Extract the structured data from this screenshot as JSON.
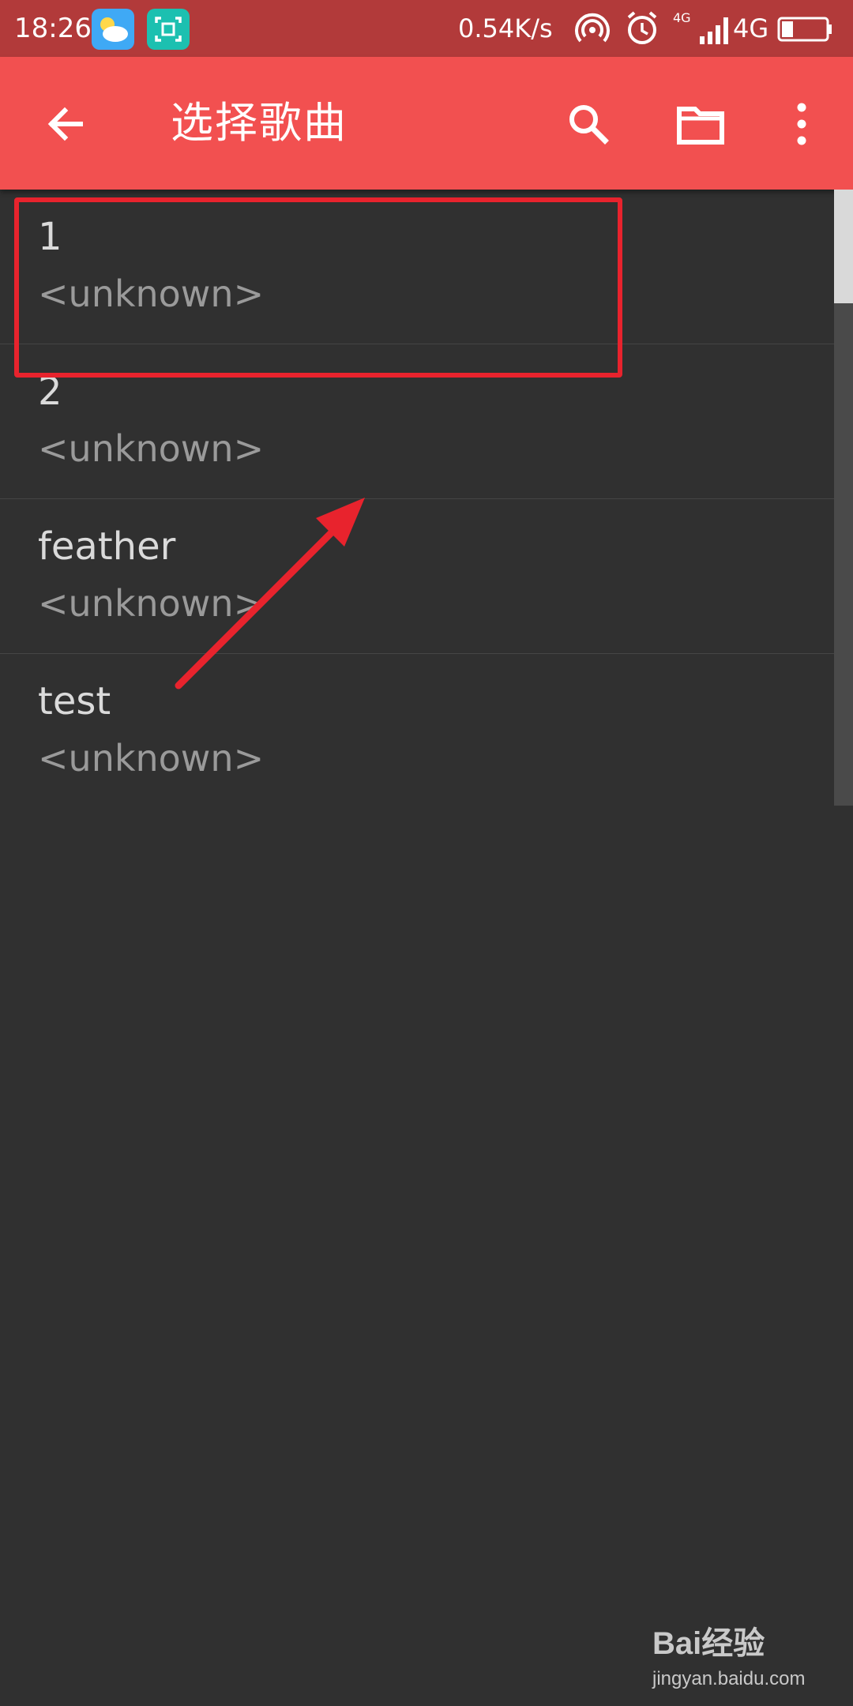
{
  "status_bar": {
    "time": "18:26",
    "network_speed": "0.54K/s",
    "network_type": "4G",
    "small_network_label": "4G",
    "icons": [
      "weather-app-icon",
      "scanner-app-icon",
      "hotspot-icon",
      "alarm-icon",
      "signal-icon",
      "battery-icon"
    ]
  },
  "app_bar": {
    "title": "选择歌曲",
    "background": "#f25050",
    "icons": [
      "back-arrow-icon",
      "search-icon",
      "folder-icon",
      "more-vert-icon"
    ]
  },
  "songs": [
    {
      "title": "1",
      "artist": "<unknown>"
    },
    {
      "title": "2",
      "artist": "<unknown>"
    },
    {
      "title": "feather",
      "artist": "<unknown>"
    },
    {
      "title": "test",
      "artist": "<unknown>"
    }
  ],
  "annotation": {
    "color": "#e8232d",
    "highlight_target": "song 1",
    "shape": "box-and-arrow"
  },
  "watermark": {
    "brand": "Bai经验",
    "url": "jingyan.baidu.com"
  }
}
